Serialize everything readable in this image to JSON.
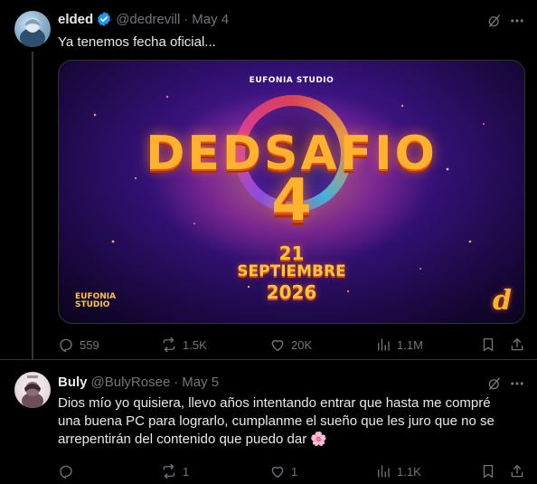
{
  "tweets": [
    {
      "author_name": "elded",
      "handle": "@dedrevill",
      "separator": "·",
      "date": "May 4",
      "verified": true,
      "text": "Ya tenemos fecha oficial...",
      "media": {
        "studio_top": "EUFONIA STUDIO",
        "title": "DEDSAFIO",
        "number": "4",
        "day": "21",
        "month": "SEPTIEMBRE",
        "year": "2026",
        "studio_bottom_line1": "EUFONIA",
        "studio_bottom_line2": "STUDIO"
      },
      "stats": {
        "replies": "559",
        "reposts": "1.5K",
        "likes": "20K",
        "views": "1.1M"
      }
    },
    {
      "author_name": "Buly",
      "handle": "@BulyRosee",
      "separator": "·",
      "date": "May 5",
      "verified": false,
      "text": "Dios mío yo quisiera, llevo años intentando entrar que hasta me compré una buena PC para lograrlo, cumplanme el sueño que les juro que no se arrepentirán del contenido que puedo dar 🌸",
      "stats": {
        "replies": "",
        "reposts": "1",
        "likes": "1",
        "views": "1.1K"
      }
    }
  ],
  "icons": [
    "verified-badge-icon",
    "grok-icon",
    "more-icon",
    "reply-icon",
    "repost-icon",
    "like-icon",
    "views-icon",
    "bookmark-icon",
    "share-icon"
  ],
  "colors": {
    "background": "#000000",
    "text_primary": "#e7e9ea",
    "text_secondary": "#71767b",
    "verified_blue": "#1d9bf0",
    "divider": "#2f3336"
  }
}
